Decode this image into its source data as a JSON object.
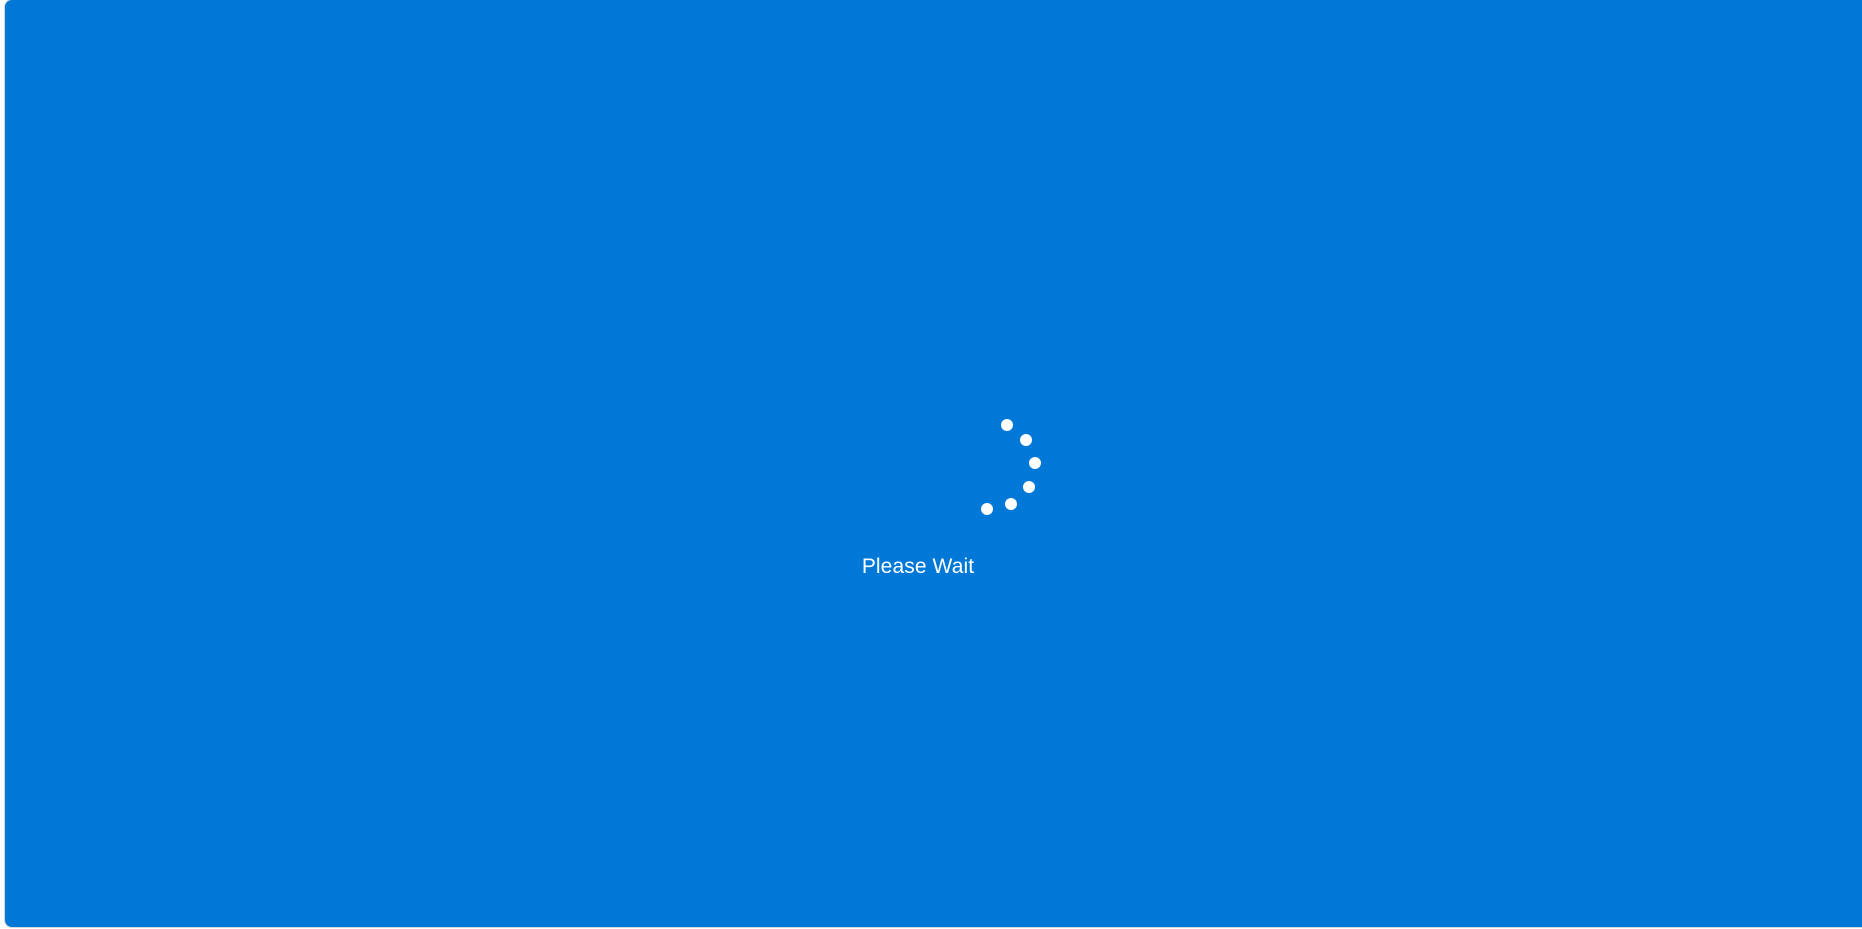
{
  "screen": {
    "background_color": "#0078d7",
    "status_text": "Please Wait"
  },
  "spinner": {
    "icon": "loading-spinner-icon",
    "color": "#ffffff",
    "dot_count": 6
  }
}
